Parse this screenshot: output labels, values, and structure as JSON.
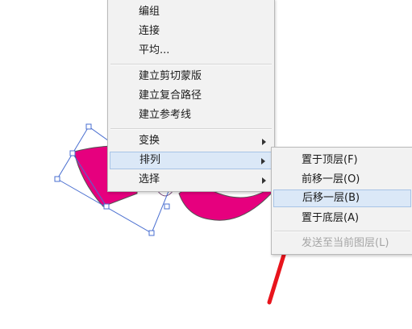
{
  "context_menu": {
    "items": [
      {
        "label": "编组"
      },
      {
        "label": "连接"
      },
      {
        "label": "平均..."
      },
      {
        "label": "建立剪切蒙版"
      },
      {
        "label": "建立复合路径"
      },
      {
        "label": "建立参考线"
      },
      {
        "label": "变换"
      },
      {
        "label": "排列"
      },
      {
        "label": "选择"
      }
    ]
  },
  "arrange_submenu": {
    "items": [
      {
        "label": "置于顶层(F)"
      },
      {
        "label": "前移一层(O)"
      },
      {
        "label": "后移一层(B)"
      },
      {
        "label": "置于底层(A)"
      },
      {
        "label": "发送至当前图层(L)"
      }
    ]
  },
  "colors": {
    "shape_fill": "#e6007e",
    "selection": "#4a6fd0",
    "menu_highlight": "#dbe8f7",
    "annotation_arrow": "#e8141c"
  },
  "icons": [
    "submenu-arrow-icon",
    "annotation-arrow-icon"
  ]
}
